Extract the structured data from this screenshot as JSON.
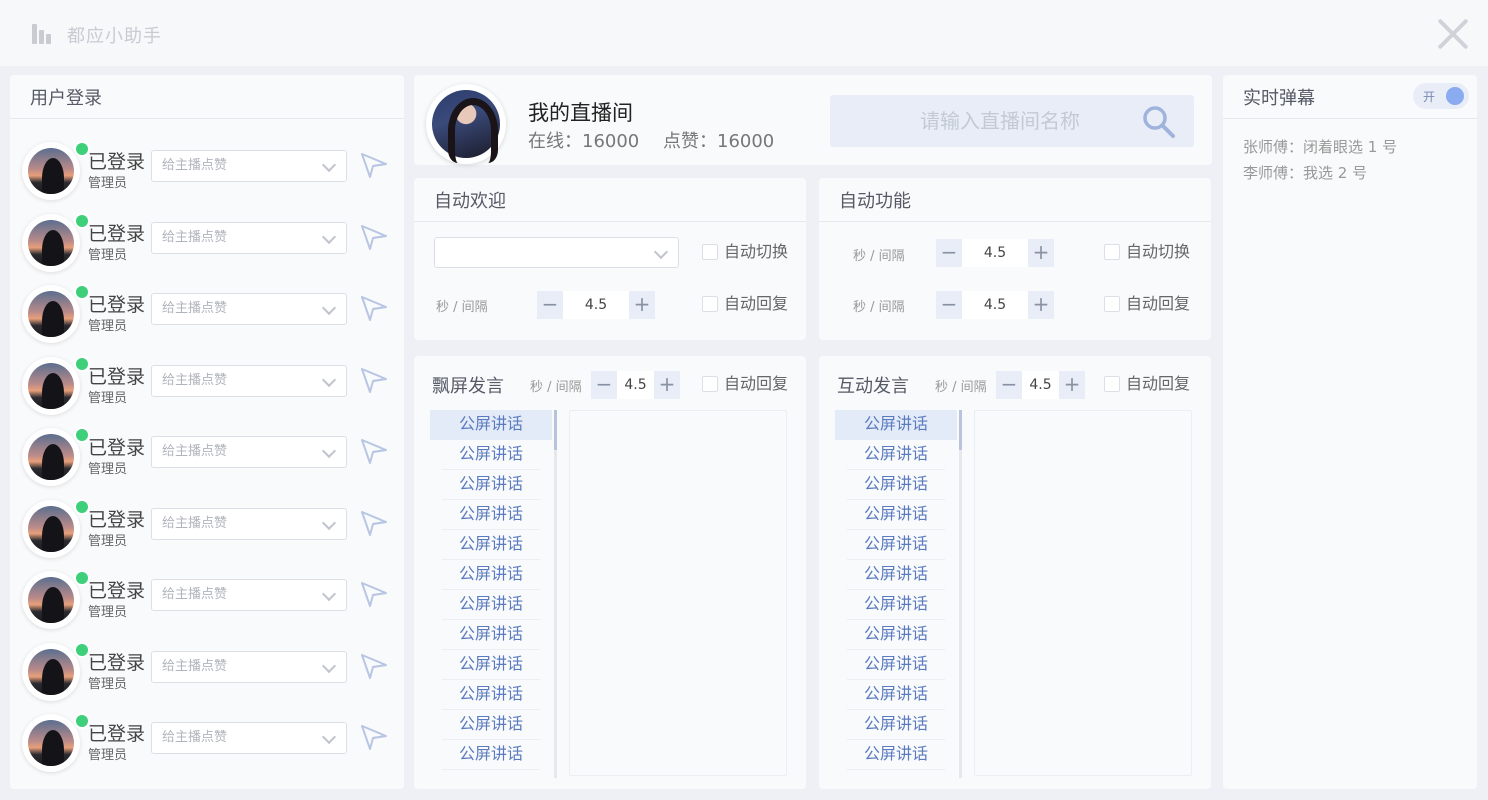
{
  "app": {
    "title": "都应小助手"
  },
  "users": {
    "title": "用户登录",
    "placeholder": "给主播点赞",
    "rows": [
      {
        "status": "已登录",
        "role": "管理员"
      },
      {
        "status": "已登录",
        "role": "管理员"
      },
      {
        "status": "已登录",
        "role": "管理员"
      },
      {
        "status": "已登录",
        "role": "管理员"
      },
      {
        "status": "已登录",
        "role": "管理员"
      },
      {
        "status": "已登录",
        "role": "管理员"
      },
      {
        "status": "已登录",
        "role": "管理员"
      },
      {
        "status": "已登录",
        "role": "管理员"
      },
      {
        "status": "已登录",
        "role": "管理员"
      }
    ]
  },
  "room": {
    "name": "我的直播间",
    "online": "在线：16000",
    "likes": "点赞：16000",
    "search_placeholder": "请输入直播间名称"
  },
  "welcome": {
    "title": "自动欢迎",
    "auto_switch": "自动切换",
    "interval_label": "秒 / 间隔",
    "interval_value": "4.5",
    "auto_reply": "自动回复"
  },
  "autofn": {
    "title": "自动功能",
    "interval_label": "秒 / 间隔",
    "interval1": "4.5",
    "interval2": "4.5",
    "auto_switch": "自动切换",
    "auto_reply": "自动回复"
  },
  "float": {
    "title": "飘屏发言",
    "interval_label": "秒 / 间隔",
    "interval_value": "4.5",
    "auto_reply": "自动回复",
    "items": [
      "公屏讲话",
      "公屏讲话",
      "公屏讲话",
      "公屏讲话",
      "公屏讲话",
      "公屏讲话",
      "公屏讲话",
      "公屏讲话",
      "公屏讲话",
      "公屏讲话",
      "公屏讲话",
      "公屏讲话"
    ]
  },
  "inter": {
    "title": "互动发言",
    "interval_label": "秒 / 间隔",
    "interval_value": "4.5",
    "auto_reply": "自动回复",
    "items": [
      "公屏讲话",
      "公屏讲话",
      "公屏讲话",
      "公屏讲话",
      "公屏讲话",
      "公屏讲话",
      "公屏讲话",
      "公屏讲话",
      "公屏讲话",
      "公屏讲话",
      "公屏讲话",
      "公屏讲话"
    ]
  },
  "danmu": {
    "title": "实时弹幕",
    "toggle": "开",
    "lines": [
      "张师傅：闭着眼选 1 号",
      "李师傅：我选 2 号"
    ]
  },
  "stepper": {
    "minus": "−",
    "plus": "+"
  },
  "colors": {
    "online": "#3ecf7a",
    "accent": "#5a7bbf",
    "toggle_on": "#8aabf0"
  }
}
